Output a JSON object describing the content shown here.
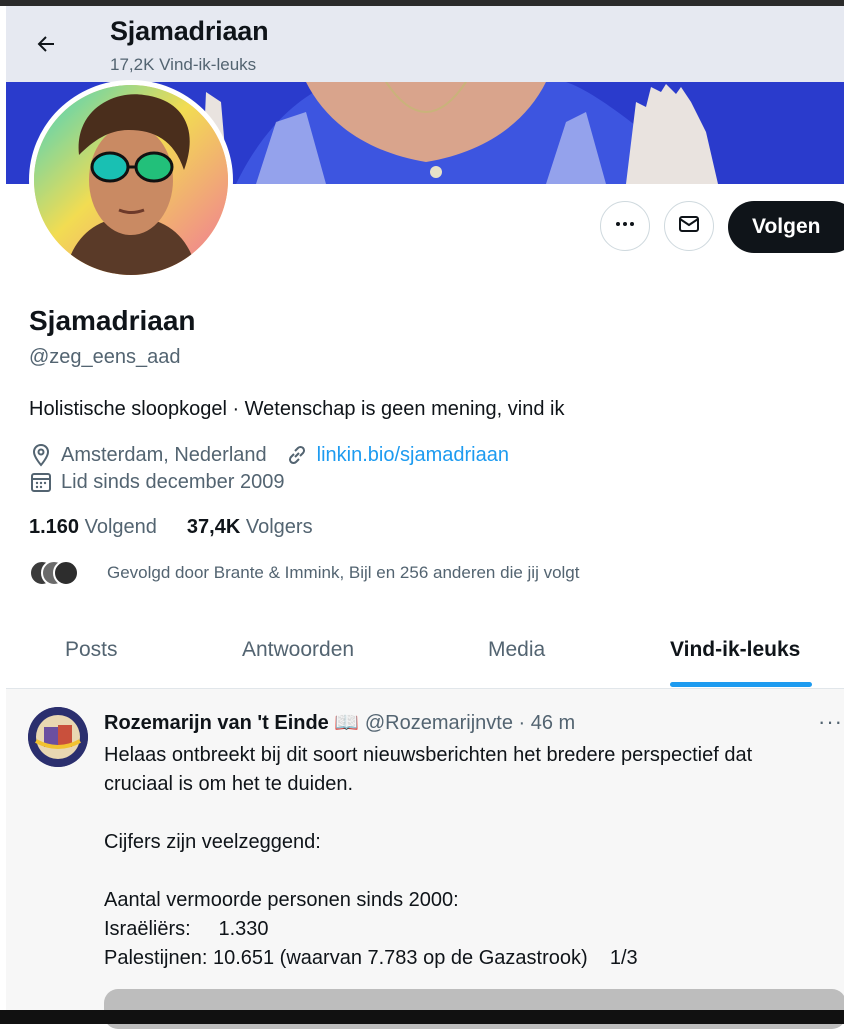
{
  "header": {
    "title": "Sjamadriaan",
    "likes_count": "17,2K Vind-ik-leuks"
  },
  "profile": {
    "name": "Sjamadriaan",
    "handle": "@zeg_eens_aad",
    "bio": "Holistische sloopkogel · Wetenschap is geen mening, vind ik",
    "location": "Amsterdam, Nederland",
    "link": "linkin.bio/sjamadriaan",
    "joined": "Lid sinds december 2009",
    "following_count": "1.160",
    "following_label": "Volgend",
    "followers_count": "37,4K",
    "followers_label": "Volgers",
    "followed_by": "Gevolgd door Brante & Immink, Bijl en 256 anderen die jij volgt",
    "follow_button": "Volgen"
  },
  "tabs": [
    "Posts",
    "Antwoorden",
    "Media",
    "Vind-ik-leuks"
  ],
  "active_tab": "Vind-ik-leuks",
  "tweet": {
    "author": "Rozemarijn van 't Einde 📖",
    "handle_time": "@Rozemarijnvte · 46 m",
    "more": "···",
    "lines": [
      "Helaas ontbreekt bij dit soort nieuwsberichten het bredere perspectief dat",
      "cruciaal is om het te duiden.",
      "",
      "Cijfers zijn veelzeggend:",
      "",
      "Aantal vermoorde personen sinds 2000:",
      "Israëliërs:     1.330",
      "Palestijnen: 10.651 (waarvan 7.783 op de Gazastrook)    1/3"
    ]
  },
  "icons": [
    "back-arrow-icon",
    "more-icon",
    "mail-icon",
    "location-icon",
    "link-icon",
    "calendar-icon"
  ],
  "colors": {
    "accent": "#1d9bf0",
    "text": "#0f1419",
    "muted": "#536471",
    "follow_bg": "#0f1419"
  }
}
